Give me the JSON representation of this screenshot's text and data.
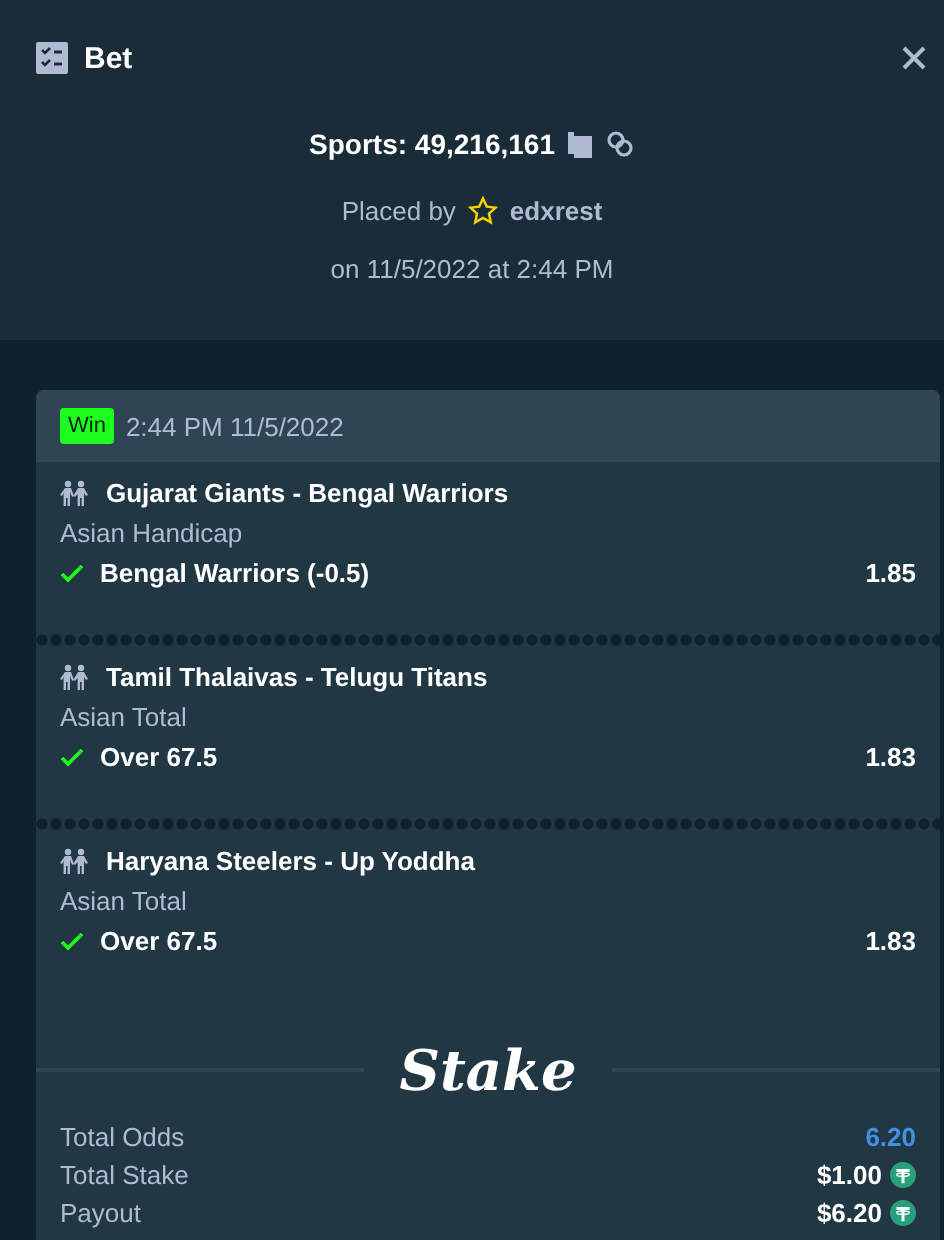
{
  "window": {
    "title": "Bet"
  },
  "bet": {
    "label": "Sports: 49,216,161",
    "placed_by": "Placed by",
    "user": "edxrest",
    "placed_on": "on 11/5/2022 at 2:44 PM"
  },
  "card": {
    "status": {
      "label": "Win",
      "color": "#1fff20"
    },
    "time": "2:44 PM 11/5/2022",
    "legs": [
      {
        "event": "Gujarat Giants - Bengal Warriors",
        "market": "Asian Handicap",
        "selection": "Bengal Warriors (-0.5)",
        "odds": "1.85",
        "won": true
      },
      {
        "event": "Tamil Thalaivas - Telugu Titans",
        "market": "Asian Total",
        "selection": "Over 67.5",
        "odds": "1.83",
        "won": true
      },
      {
        "event": "Haryana Steelers - Up Yoddha",
        "market": "Asian Total",
        "selection": "Over 67.5",
        "odds": "1.83",
        "won": true
      }
    ],
    "logo": "Stake",
    "totals": [
      {
        "label": "Total Odds",
        "value": "6.20",
        "kind": "odds"
      },
      {
        "label": "Total Stake",
        "value": "$1.00",
        "kind": "money"
      },
      {
        "label": "Payout",
        "value": "$6.20",
        "kind": "money"
      }
    ]
  }
}
